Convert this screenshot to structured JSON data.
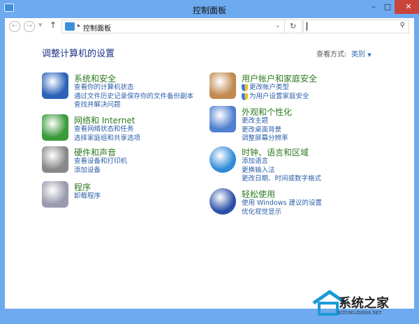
{
  "window": {
    "title": "控制面板"
  },
  "address": {
    "crumb": "控制面板"
  },
  "search": {
    "placeholder": ""
  },
  "main": {
    "heading": "调整计算机的设置",
    "view_by_label": "查看方式:",
    "view_by_value": "类别"
  },
  "left": [
    {
      "title": "系统和安全",
      "icon": "shield-icon",
      "links": [
        "查看你的计算机状态",
        "通过文件历史记录保存你的文件备份副本",
        "查找并解决问题"
      ]
    },
    {
      "title": "网络和 Internet",
      "icon": "network-icon",
      "links": [
        "查看网络状态和任务",
        "选择家庭组和共享选项"
      ]
    },
    {
      "title": "硬件和声音",
      "icon": "printer-icon",
      "links": [
        "查看设备和打印机",
        "添加设备"
      ]
    },
    {
      "title": "程序",
      "icon": "programs-icon",
      "links": [
        "卸载程序"
      ]
    }
  ],
  "right": [
    {
      "title": "用户帐户和家庭安全",
      "icon": "users-icon",
      "links": [
        "更改帐户类型",
        "为用户设置家庭安全"
      ]
    },
    {
      "title": "外观和个性化",
      "icon": "appearance-icon",
      "links": [
        "更改主题",
        "更改桌面背景",
        "调整屏幕分辨率"
      ]
    },
    {
      "title": "时钟、语言和区域",
      "icon": "clock-globe-icon",
      "links": [
        "添加语言",
        "更换输入法",
        "更改日期、时间或数字格式"
      ]
    },
    {
      "title": "轻松使用",
      "icon": "ease-of-access-icon",
      "links": [
        "使用 Windows 建议的设置",
        "优化视觉显示"
      ]
    }
  ],
  "watermark": {
    "name": "系统之家",
    "url": "XITONGZHIJIA.NET"
  }
}
